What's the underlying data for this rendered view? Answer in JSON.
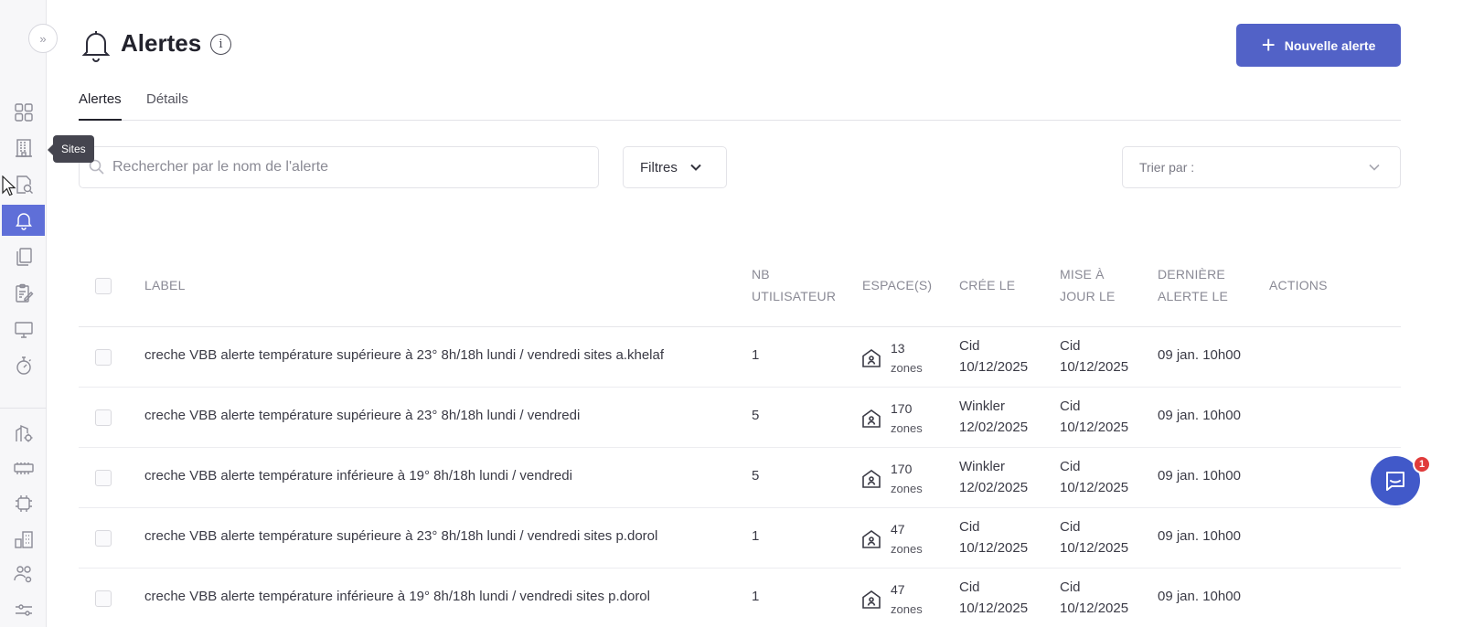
{
  "sidebar": {
    "expand_icon": "double-chevron-right-icon",
    "tooltip": "Sites",
    "items": [
      {
        "icon": "dashboard-grid-icon"
      },
      {
        "icon": "building-icon"
      },
      {
        "icon": "document-search-icon"
      },
      {
        "icon": "bell-icon",
        "active": true
      },
      {
        "icon": "documents-icon"
      },
      {
        "icon": "edit-report-icon"
      },
      {
        "icon": "monitor-icon"
      },
      {
        "icon": "stopwatch-icon"
      },
      {
        "icon": "building-settings-icon"
      },
      {
        "icon": "meter-icon"
      },
      {
        "icon": "iot-device-icon"
      },
      {
        "icon": "buildings-icon"
      },
      {
        "icon": "users-settings-icon"
      },
      {
        "icon": "sliders-icon"
      }
    ]
  },
  "header": {
    "title": "Alertes",
    "info_icon": "info-icon",
    "new_button_label": "Nouvelle alerte"
  },
  "tabs": [
    {
      "label": "Alertes",
      "active": true
    },
    {
      "label": "Détails",
      "active": false
    }
  ],
  "search": {
    "placeholder": "Rechercher par le nom de l'alerte",
    "value": ""
  },
  "filters": {
    "label": "Filtres"
  },
  "sort": {
    "placeholder": "Trier par :"
  },
  "table": {
    "columns": {
      "label": "LABEL",
      "nb_line1": "NB",
      "nb_line2": "UTILISATEUR",
      "espaces": "ESPACE(S)",
      "cree": "CRÉE LE",
      "maj_line1": "MISE À",
      "maj_line2": "JOUR LE",
      "derniere_line1": "DERNIÈRE",
      "derniere_line2": "ALERTE LE",
      "actions": "ACTIONS"
    },
    "rows": [
      {
        "label": "creche VBB alerte température supérieure à 23° 8h/18h lundi / vendredi sites a.khelaf",
        "nb": "1",
        "zones_count": "13",
        "zones_unit": "zones",
        "created_by": "Cid",
        "created_date": "10/12/2025",
        "updated_by": "Cid",
        "updated_date": "10/12/2025",
        "last_alert": "09 jan. 10h00"
      },
      {
        "label": "creche VBB alerte température supérieure à 23° 8h/18h lundi / vendredi",
        "nb": "5",
        "zones_count": "170",
        "zones_unit": "zones",
        "created_by": "Winkler",
        "created_date": "12/02/2025",
        "updated_by": "Cid",
        "updated_date": "10/12/2025",
        "last_alert": "09 jan. 10h00"
      },
      {
        "label": "creche VBB alerte température inférieure à 19° 8h/18h lundi / vendredi",
        "nb": "5",
        "zones_count": "170",
        "zones_unit": "zones",
        "created_by": "Winkler",
        "created_date": "12/02/2025",
        "updated_by": "Cid",
        "updated_date": "10/12/2025",
        "last_alert": "09 jan. 10h00"
      },
      {
        "label": "creche VBB alerte température supérieure à 23° 8h/18h lundi / vendredi sites p.dorol",
        "nb": "1",
        "zones_count": "47",
        "zones_unit": "zones",
        "created_by": "Cid",
        "created_date": "10/12/2025",
        "updated_by": "Cid",
        "updated_date": "10/12/2025",
        "last_alert": "09 jan. 10h00"
      },
      {
        "label": "creche VBB alerte température inférieure à 19° 8h/18h lundi / vendredi sites p.dorol",
        "nb": "1",
        "zones_count": "47",
        "zones_unit": "zones",
        "created_by": "Cid",
        "created_date": "10/12/2025",
        "updated_by": "Cid",
        "updated_date": "10/12/2025",
        "last_alert": "09 jan. 10h00"
      }
    ]
  },
  "chat": {
    "icon": "chat-icon",
    "badge": "1"
  },
  "colors": {
    "accent": "#5262c7",
    "sidebar_active": "#5f6fd8",
    "badge": "#e03b3b"
  }
}
